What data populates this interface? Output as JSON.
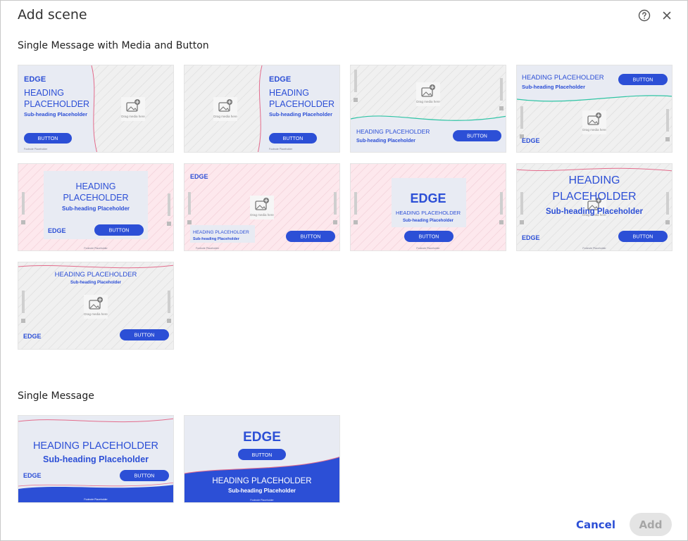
{
  "dialog": {
    "title": "Add scene",
    "help_icon": "help-circle-icon",
    "close_icon": "close-icon"
  },
  "sections": [
    {
      "label": "Single Message with Media and Button"
    },
    {
      "label": "Single Message"
    }
  ],
  "template_text": {
    "logo": "EDGE",
    "heading": "HEADING PLACEHOLDER",
    "heading_line1": "HEADING",
    "heading_line2": "PLACEHOLDER",
    "subheading": "Sub-heading Placeholder",
    "button": "BUTTON",
    "drag_media": "Drag media here",
    "footnote": "Footnote Placeholder"
  },
  "footer": {
    "cancel_label": "Cancel",
    "add_label": "Add"
  },
  "colors": {
    "accent": "#2c4fd6",
    "panel": "#e8ebf3",
    "pink_bg": "#fbe3e8",
    "gray_bg": "#f1f1f1",
    "wave_pink": "#e36b8b",
    "wave_teal": "#2fc4a4",
    "disabled_bg": "#e4e4e4",
    "disabled_text": "#a6a6a6"
  }
}
